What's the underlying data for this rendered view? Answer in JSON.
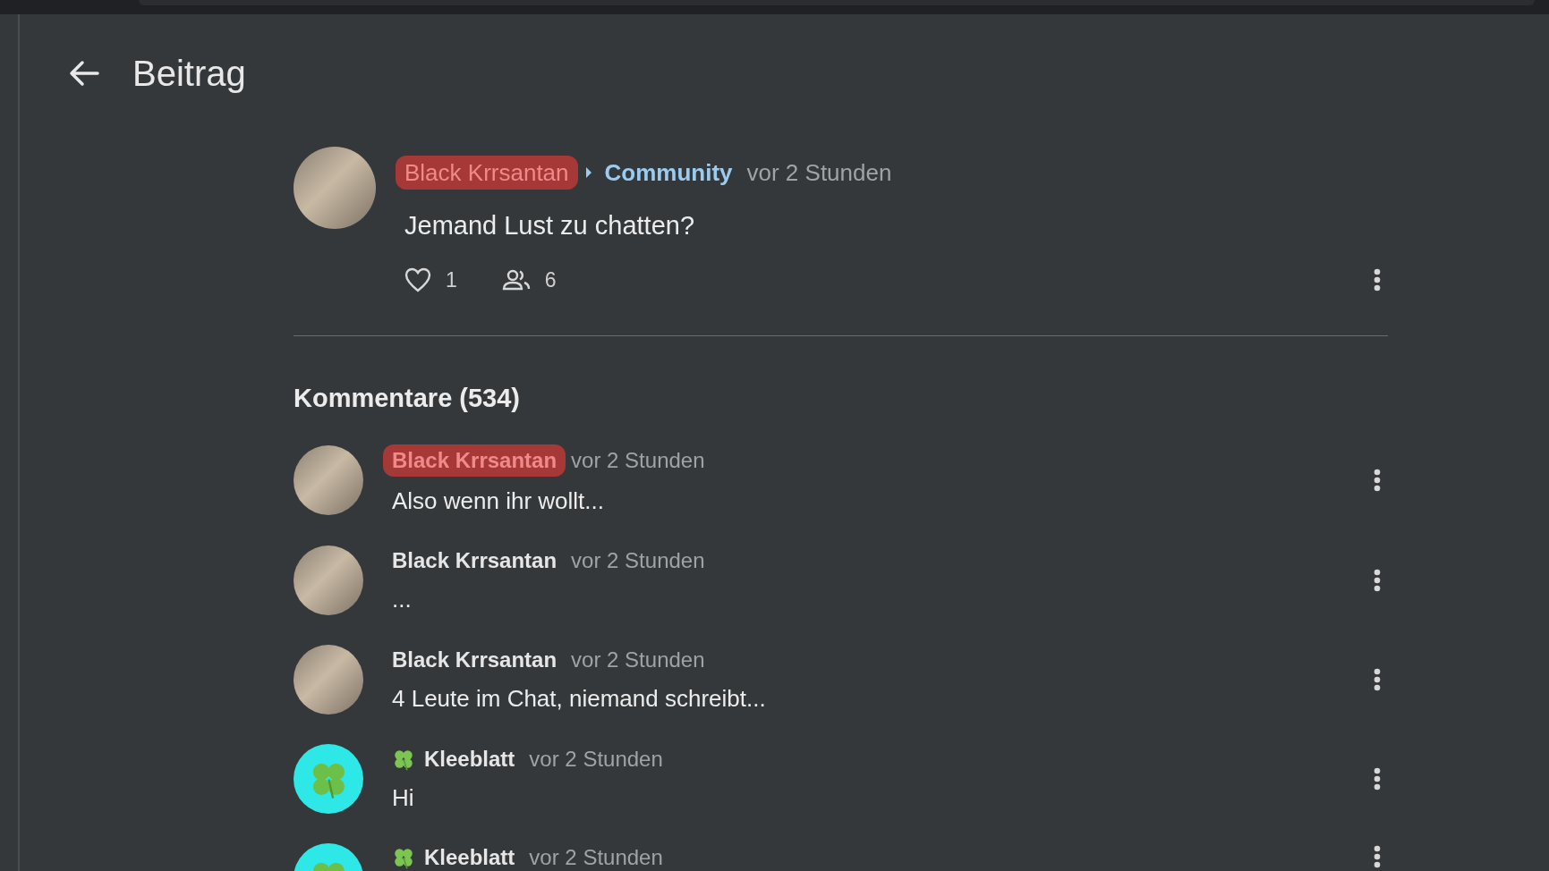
{
  "header": {
    "title": "Beitrag"
  },
  "post": {
    "avatar": {
      "kind": "photo"
    },
    "author": "Black Krrsantan",
    "author_marked": true,
    "community": "Community",
    "time": "vor 2 Stunden",
    "text": "Jemand Lust zu chatten?",
    "likes": "1",
    "participants": "6"
  },
  "comments_heading": "Kommentare (534)",
  "comments": [
    {
      "avatar": {
        "kind": "photo"
      },
      "author_icon": false,
      "author": "Black Krrsantan",
      "author_marked": true,
      "time": "vor 2 Stunden",
      "text": "Also wenn ihr wollt..."
    },
    {
      "avatar": {
        "kind": "photo"
      },
      "author_icon": false,
      "author": "Black Krrsantan",
      "author_marked": false,
      "time": "vor 2 Stunden",
      "text": "..."
    },
    {
      "avatar": {
        "kind": "photo"
      },
      "author_icon": false,
      "author": "Black Krrsantan",
      "author_marked": false,
      "time": "vor 2 Stunden",
      "text": "4 Leute im Chat, niemand schreibt..."
    },
    {
      "avatar": {
        "kind": "clover"
      },
      "author_icon": true,
      "author": "Kleeblatt",
      "author_marked": false,
      "time": "vor 2 Stunden",
      "text": "Hi"
    },
    {
      "avatar": {
        "kind": "clover"
      },
      "author_icon": true,
      "author": "Kleeblatt",
      "author_marked": false,
      "time": "vor 2 Stunden"
    }
  ]
}
